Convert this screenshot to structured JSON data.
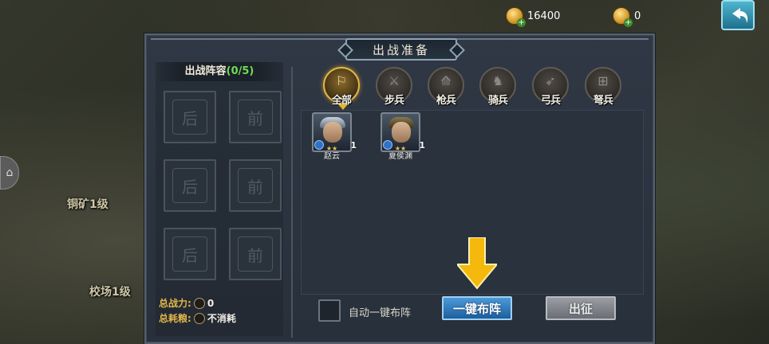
{
  "resources": {
    "gold": "16400",
    "ingot": "0"
  },
  "map_labels": {
    "copper_mine": "铜矿1级",
    "drill_ground": "校场1级"
  },
  "panel": {
    "title": "出战准备"
  },
  "lineup": {
    "heading": "出战阵容",
    "count": "(0/5)",
    "slots": [
      "后",
      "前",
      "后",
      "前",
      "后",
      "前"
    ],
    "power_label": "总战力:",
    "power_value": "0",
    "food_label": "总耗粮:",
    "food_value": "不消耗"
  },
  "filters": [
    {
      "label": "全部",
      "glyph": "⚐",
      "active": true
    },
    {
      "label": "步兵",
      "glyph": "⚔",
      "active": false
    },
    {
      "label": "枪兵",
      "glyph": "⟰",
      "active": false
    },
    {
      "label": "骑兵",
      "glyph": "♞",
      "active": false
    },
    {
      "label": "弓兵",
      "glyph": "➶",
      "active": false
    },
    {
      "label": "弩兵",
      "glyph": "⊞",
      "active": false
    }
  ],
  "heroes": [
    {
      "name": "赵云",
      "level": "1",
      "stars": "★★"
    },
    {
      "name": "夏侯渊",
      "level": "1",
      "stars": "★★"
    }
  ],
  "controls": {
    "auto_label": "自动一键布阵",
    "auto_button": "一键布阵",
    "go_button": "出征"
  },
  "colors": {
    "accent_gold": "#e3b64a",
    "count_green": "#6fdc54",
    "auto_button_blue": "#1b5e9e",
    "arrow_yellow": "#f5b80c"
  }
}
